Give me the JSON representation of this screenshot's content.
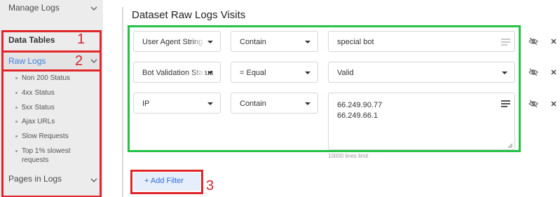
{
  "sidebar": {
    "manage_logs": "Manage Logs",
    "data_tables": "Data Tables",
    "raw_logs": "Raw Logs",
    "raw_logs_items": [
      "Non 200 Status",
      "4xx Status",
      "5xx Status",
      "Ajax URLs",
      "Slow Requests",
      "Top 1% slowest",
      "requests"
    ],
    "pages_in_logs": "Pages in Logs"
  },
  "annotations": {
    "n1": "1",
    "n2": "2",
    "n3": "3"
  },
  "main": {
    "title": "Dataset Raw Logs Visits",
    "filters": [
      {
        "field": "User Agent String",
        "operator": "Contain",
        "value": "special bot"
      },
      {
        "field": "Bot Validation Status",
        "operator": "= Equal",
        "value": "Valid"
      },
      {
        "field": "IP",
        "operator": "Contain",
        "value": "66.249.90.77\n66.249.66.1"
      }
    ],
    "limit_note": "10000 lines limit",
    "add_filter": "+ Add Filter"
  },
  "colors": {
    "accent": "#3d7ee1",
    "annotation_red": "#e0262a",
    "annotation_green": "#22c244"
  }
}
